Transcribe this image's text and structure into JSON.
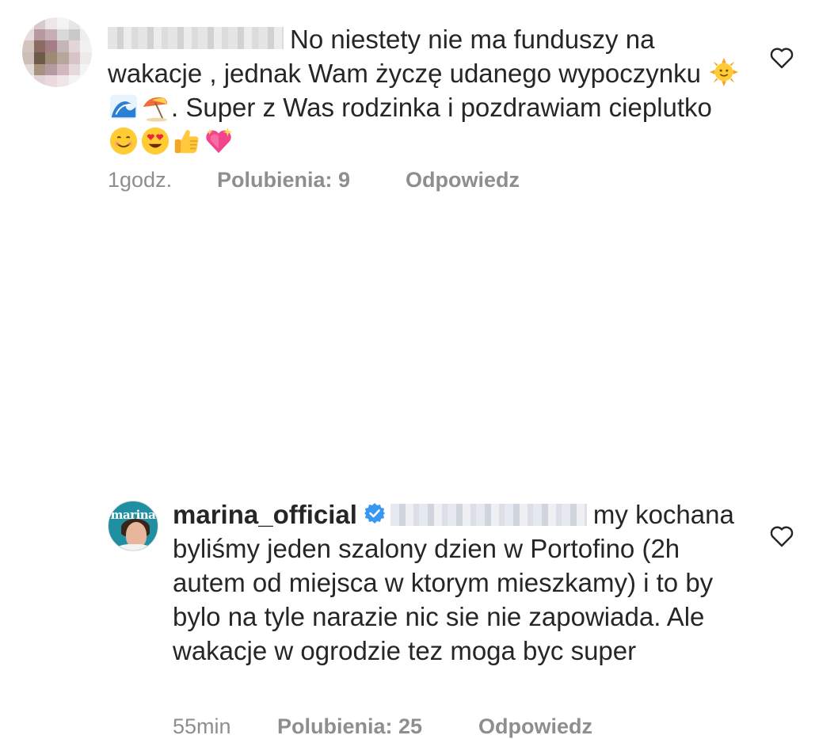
{
  "comments": [
    {
      "username": "",
      "text_parts": [
        "No niestety nie ma funduszy na wakacje , jednak Wam życzę udanego wypoczynku ",
        ". Super z Was rodzinka i pozdrawiam cieplutko "
      ],
      "emojis_mid": [
        "sun-with-face",
        "water-wave",
        "beach-umbrella"
      ],
      "emojis_end": [
        "smiling-face",
        "heart-eyes-face",
        "thumbs-up",
        "sparkling-heart"
      ],
      "time": "1godz.",
      "likes": "Polubienia: 9",
      "reply": "Odpowiedz"
    },
    {
      "username": "marina_official",
      "verified": true,
      "avatar_logo": "marina",
      "text": "my kochana byliśmy jeden szalony dzien w Portofino (2h autem od miejsca w ktorym mieszkamy) i to by bylo na tyle narazie nic sie nie zapowiada. Ale wakacje w ogrodzie tez moga byc super",
      "time": "55min",
      "likes": "Polubienia: 25",
      "reply": "Odpowiedz"
    }
  ],
  "colors": {
    "text": "#262626",
    "meta": "#8e8e8e",
    "verified": "#3897f0"
  }
}
